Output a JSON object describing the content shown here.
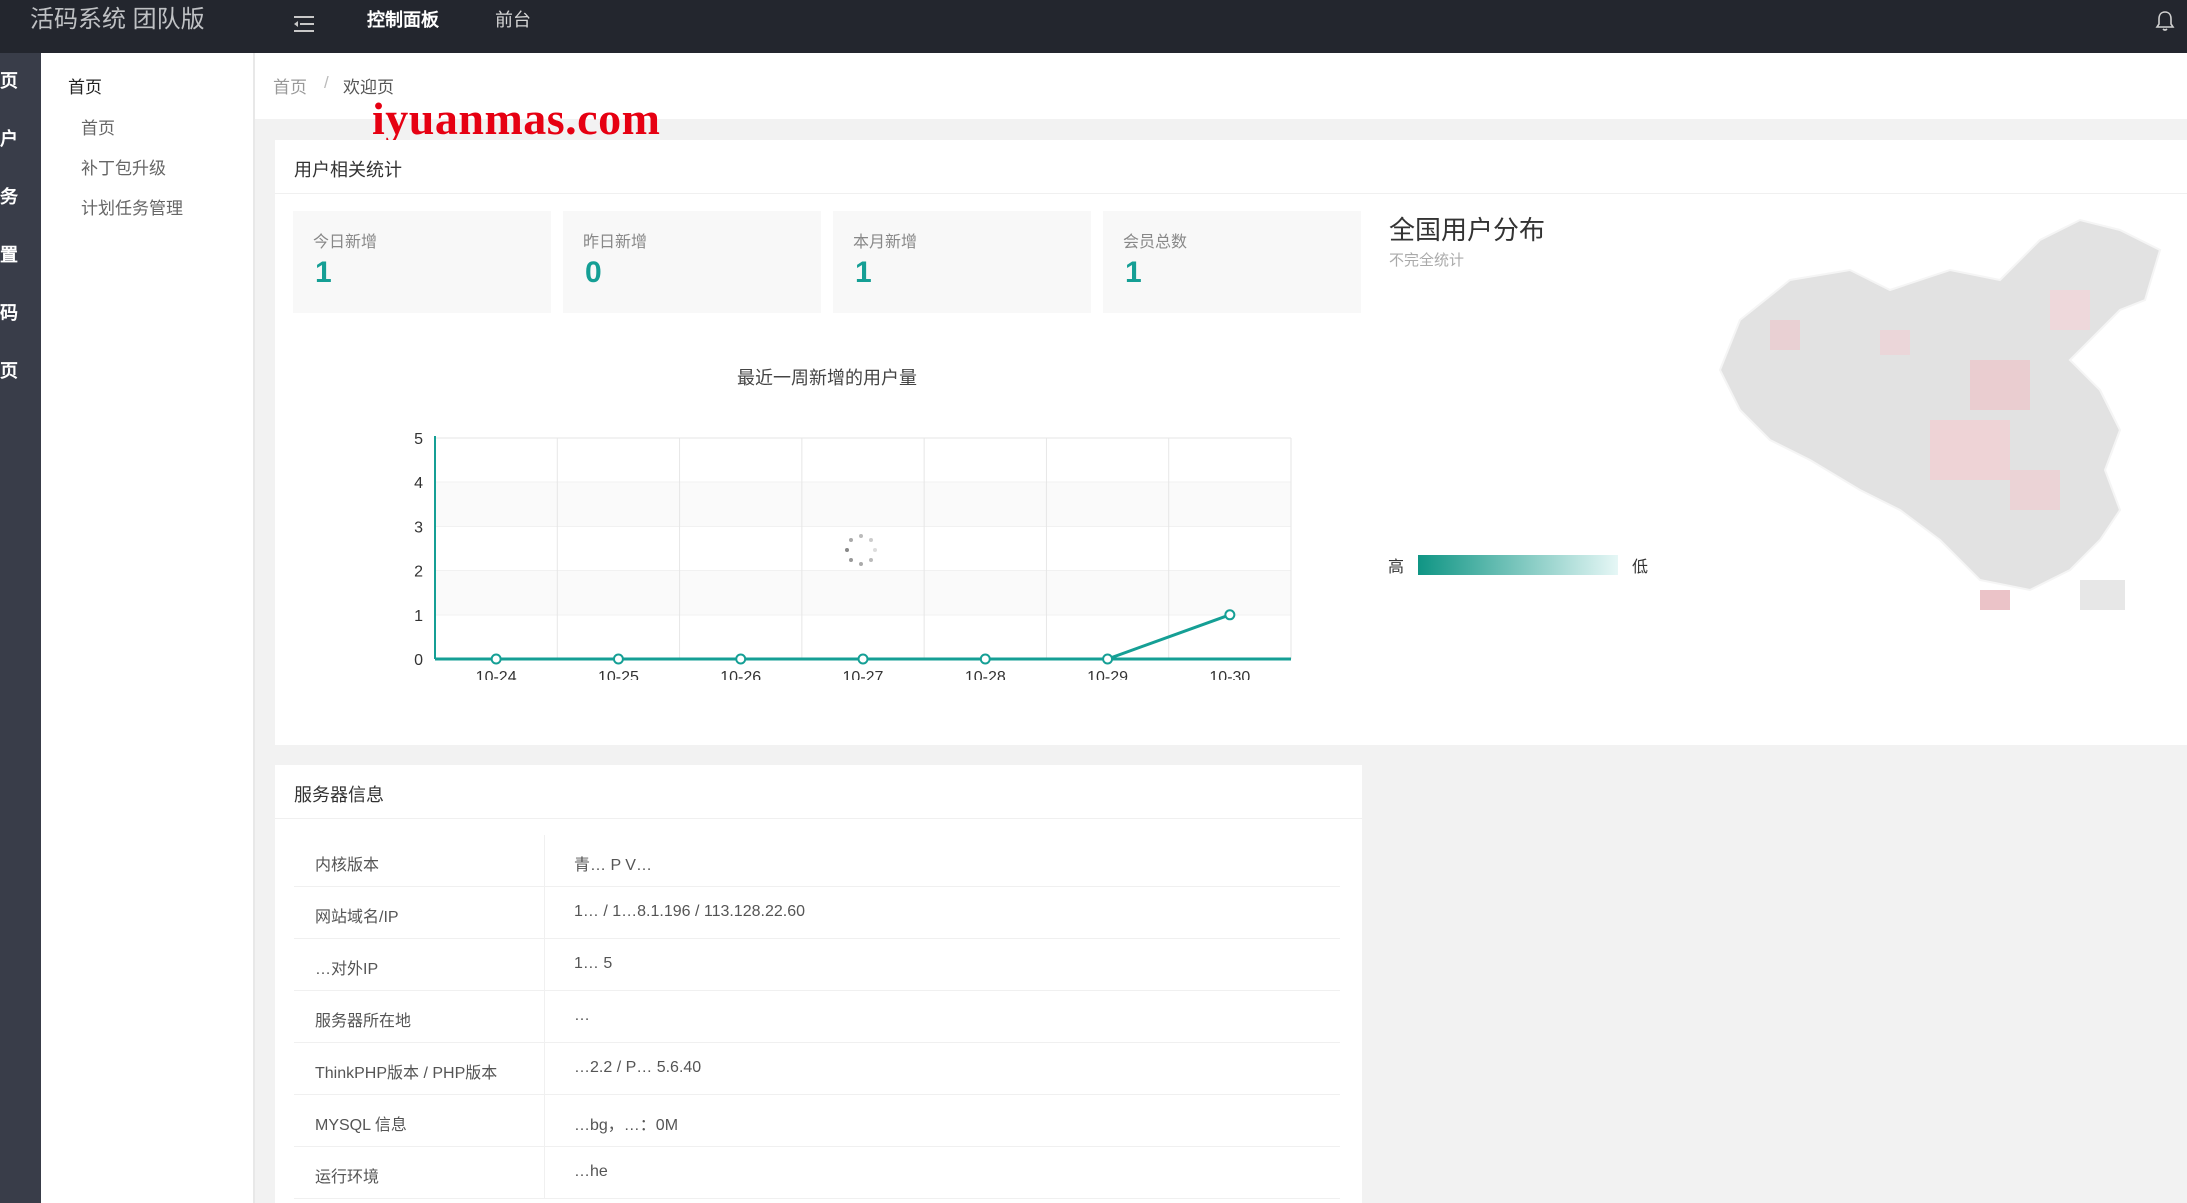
{
  "header": {
    "app_title": "活码系统 团队版",
    "nav_active": "控制面板",
    "nav_front": "前台"
  },
  "rail": {
    "items": [
      "页",
      "户",
      "务",
      "置",
      "码",
      "页"
    ]
  },
  "subnav": {
    "title": "首页",
    "items": [
      "首页",
      "补丁包升级",
      "计划任务管理"
    ]
  },
  "breadcrumb": {
    "home": "首页",
    "separator": "/",
    "current": "欢迎页"
  },
  "watermark": "iyuanmas.com",
  "stats": {
    "title": "用户相关统计",
    "boxes": [
      {
        "label": "今日新增",
        "value": "1"
      },
      {
        "label": "昨日新增",
        "value": "0"
      },
      {
        "label": "本月新增",
        "value": "1"
      },
      {
        "label": "会员总数",
        "value": "1"
      }
    ],
    "accent_color": "#159f95"
  },
  "chart_data": {
    "type": "line",
    "title": "最近一周新增的用户量",
    "categories": [
      "10-24",
      "10-25",
      "10-26",
      "10-27",
      "10-28",
      "10-29",
      "10-30"
    ],
    "values": [
      0,
      0,
      0,
      0,
      0,
      0,
      1
    ],
    "xlabel": "",
    "ylabel": "",
    "ylim": [
      0,
      5
    ],
    "yticks": [
      0,
      1,
      2,
      3,
      4,
      5
    ],
    "grid": true,
    "color": "#159f95"
  },
  "map": {
    "title": "全国用户分布",
    "subtitle": "不完全统计",
    "legend_high": "高",
    "legend_low": "低"
  },
  "server": {
    "title": "服务器信息",
    "rows": [
      {
        "key": "内核版本",
        "value": "青… P V…"
      },
      {
        "key": "网站域名/IP",
        "value": "1… / 1…8.1.196 / 113.128.22.60"
      },
      {
        "key": "…对外IP",
        "value": "1… 5"
      },
      {
        "key": "服务器所在地",
        "value": "…"
      },
      {
        "key": "ThinkPHP版本 / PHP版本",
        "value": "…2.2 / P… 5.6.40"
      },
      {
        "key": "MYSQL 信息",
        "value": "…bg，…：0M"
      },
      {
        "key": "运行环境",
        "value": "…he"
      }
    ]
  }
}
